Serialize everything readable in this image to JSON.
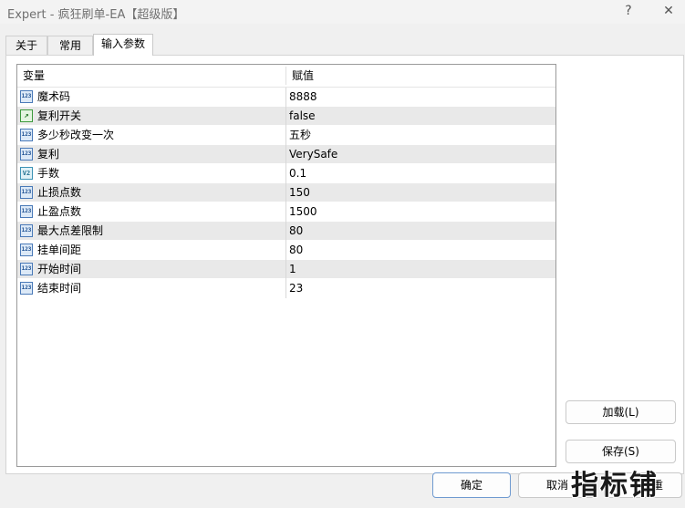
{
  "window": {
    "title": "Expert - 疯狂刷单-EA【超级版】",
    "help_glyph": "?",
    "close_glyph": "✕"
  },
  "tabs": [
    {
      "label": "关于",
      "active": false
    },
    {
      "label": "常用",
      "active": false
    },
    {
      "label": "输入参数",
      "active": true
    }
  ],
  "grid": {
    "headers": {
      "variable": "变量",
      "value": "赋值"
    },
    "icon_labels": {
      "int": "123",
      "bool": "↗",
      "dbl": "V2"
    },
    "rows": [
      {
        "icon": "int",
        "name": "魔术码",
        "value": "8888"
      },
      {
        "icon": "bool",
        "name": "复利开关",
        "value": "false"
      },
      {
        "icon": "int",
        "name": "多少秒改变一次",
        "value": "五秒"
      },
      {
        "icon": "int",
        "name": "复利",
        "value": "VerySafe"
      },
      {
        "icon": "dbl",
        "name": "手数",
        "value": "0.1"
      },
      {
        "icon": "int",
        "name": "止损点数",
        "value": "150"
      },
      {
        "icon": "int",
        "name": "止盈点数",
        "value": "1500"
      },
      {
        "icon": "int",
        "name": "最大点差限制",
        "value": "80"
      },
      {
        "icon": "int",
        "name": "挂单间距",
        "value": "80"
      },
      {
        "icon": "int",
        "name": "开始时间",
        "value": "1"
      },
      {
        "icon": "int",
        "name": "结束时间",
        "value": "23"
      }
    ]
  },
  "buttons": {
    "load": "加载(L)",
    "save": "保存(S)",
    "ok": "确定",
    "cancel": "取消",
    "reset_partial": "重"
  },
  "watermark": "指标铺"
}
